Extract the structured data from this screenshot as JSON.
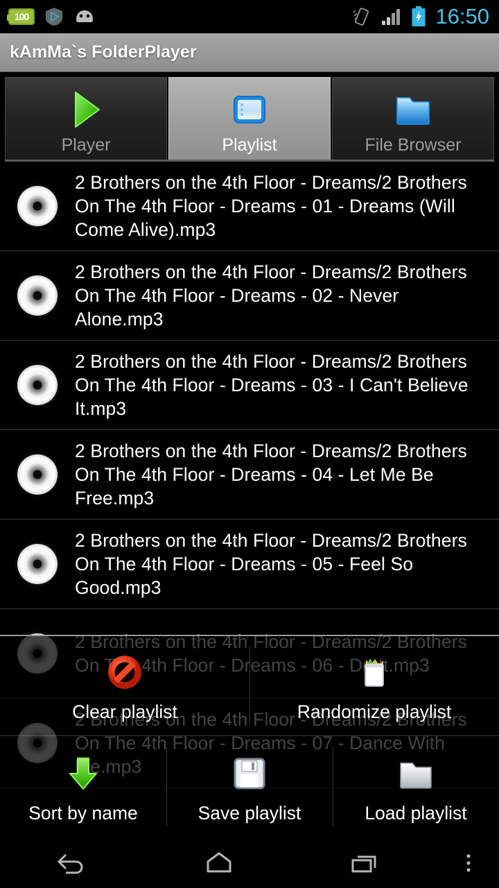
{
  "status_bar": {
    "icons_left": [
      "battery-100-badge-icon",
      "play-store-icon",
      "android-head-icon"
    ],
    "battery_badge_text": "100",
    "icons_right": [
      "auto-rotate-icon",
      "signal-bars-icon",
      "battery-charging-icon"
    ],
    "time": "16:50",
    "time_color": "#40c4e8"
  },
  "title_bar": {
    "title": "kAmMa`s FolderPlayer"
  },
  "tabs": [
    {
      "label": "Player",
      "icon": "play-triangle-icon",
      "selected": false
    },
    {
      "label": "Playlist",
      "icon": "playlist-icon",
      "selected": true
    },
    {
      "label": "File Browser",
      "icon": "folder-blue-icon",
      "selected": false
    }
  ],
  "playlist": {
    "item_icon": "cd-disc-icon",
    "items": [
      {
        "title": "2 Brothers on the 4th Floor - Dreams/2 Brothers On The 4th Floor - Dreams - 01 - Dreams (Will Come Alive).mp3"
      },
      {
        "title": "2 Brothers on the 4th Floor - Dreams/2 Brothers On The 4th Floor - Dreams - 02 - Never Alone.mp3"
      },
      {
        "title": "2 Brothers on the 4th Floor - Dreams/2 Brothers On The 4th Floor - Dreams - 03 - I Can't Believe It.mp3"
      },
      {
        "title": "2 Brothers on the 4th Floor - Dreams/2 Brothers On The 4th Floor - Dreams - 04 - Let Me Be Free.mp3"
      },
      {
        "title": "2 Brothers on the 4th Floor - Dreams/2 Brothers On The 4th Floor - Dreams - 05 - Feel So Good.mp3"
      },
      {
        "title": "2 Brothers on the 4th Floor - Dreams/2 Brothers On The 4th Floor - Dreams - 06 - Do It.mp3"
      },
      {
        "title": "2 Brothers on the 4th Floor - Dreams/2 Brothers On The 4th Floor - Dreams - 07 - Dance With Me.mp3"
      }
    ]
  },
  "options_menu": {
    "row1": [
      {
        "label": "Clear playlist",
        "icon": "no-entry-red-icon"
      },
      {
        "label": "Randomize playlist",
        "icon": "shuffle-bucket-icon"
      }
    ],
    "row2": [
      {
        "label": "Sort by name",
        "icon": "arrow-down-green-icon"
      },
      {
        "label": "Save playlist",
        "icon": "floppy-disk-icon"
      },
      {
        "label": "Load playlist",
        "icon": "folder-white-icon"
      }
    ]
  },
  "nav_bar": {
    "buttons": [
      {
        "name": "back",
        "icon": "back-arrow-icon"
      },
      {
        "name": "home",
        "icon": "home-icon"
      },
      {
        "name": "recents",
        "icon": "recents-icon"
      },
      {
        "name": "overflow",
        "icon": "overflow-dots-icon"
      }
    ]
  }
}
